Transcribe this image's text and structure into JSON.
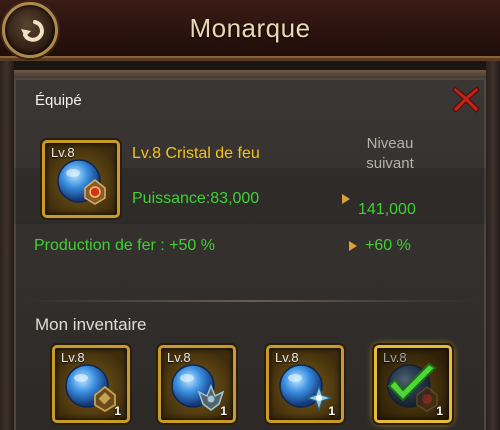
{
  "header": {
    "title": "Monarque"
  },
  "panel": {
    "equipped_label": "Équipé",
    "item": {
      "level_badge": "Lv.8",
      "name": "Lv.8 Cristal de feu"
    },
    "power_text": "Puissance:83,000",
    "iron_text": "Production de fer : +50 %",
    "next_level_label": "Niveau\nsuivant",
    "next_power": "141,000",
    "next_iron": "+60 %"
  },
  "inventory": {
    "label": "Mon inventaire",
    "items": [
      {
        "level": "Lv.8",
        "count": "1",
        "emblem_color": "#c7a34a",
        "equipped": false
      },
      {
        "level": "Lv.8",
        "count": "1",
        "emblem_color": "#9cc7d3",
        "equipped": false
      },
      {
        "level": "Lv.8",
        "count": "1",
        "emblem_color": "#8fd0ef",
        "equipped": false
      },
      {
        "level": "Lv.8",
        "count": "1",
        "emblem_color": "#c0392b",
        "equipped": true
      }
    ]
  },
  "colors": {
    "accent_gold": "#f3c21d",
    "stat_green": "#3ed233",
    "close_red": "#c0241a"
  },
  "icons": [
    "back-arrow-icon",
    "close-icon",
    "crystal-icon",
    "checkmark-icon",
    "arrow-right-icon"
  ]
}
